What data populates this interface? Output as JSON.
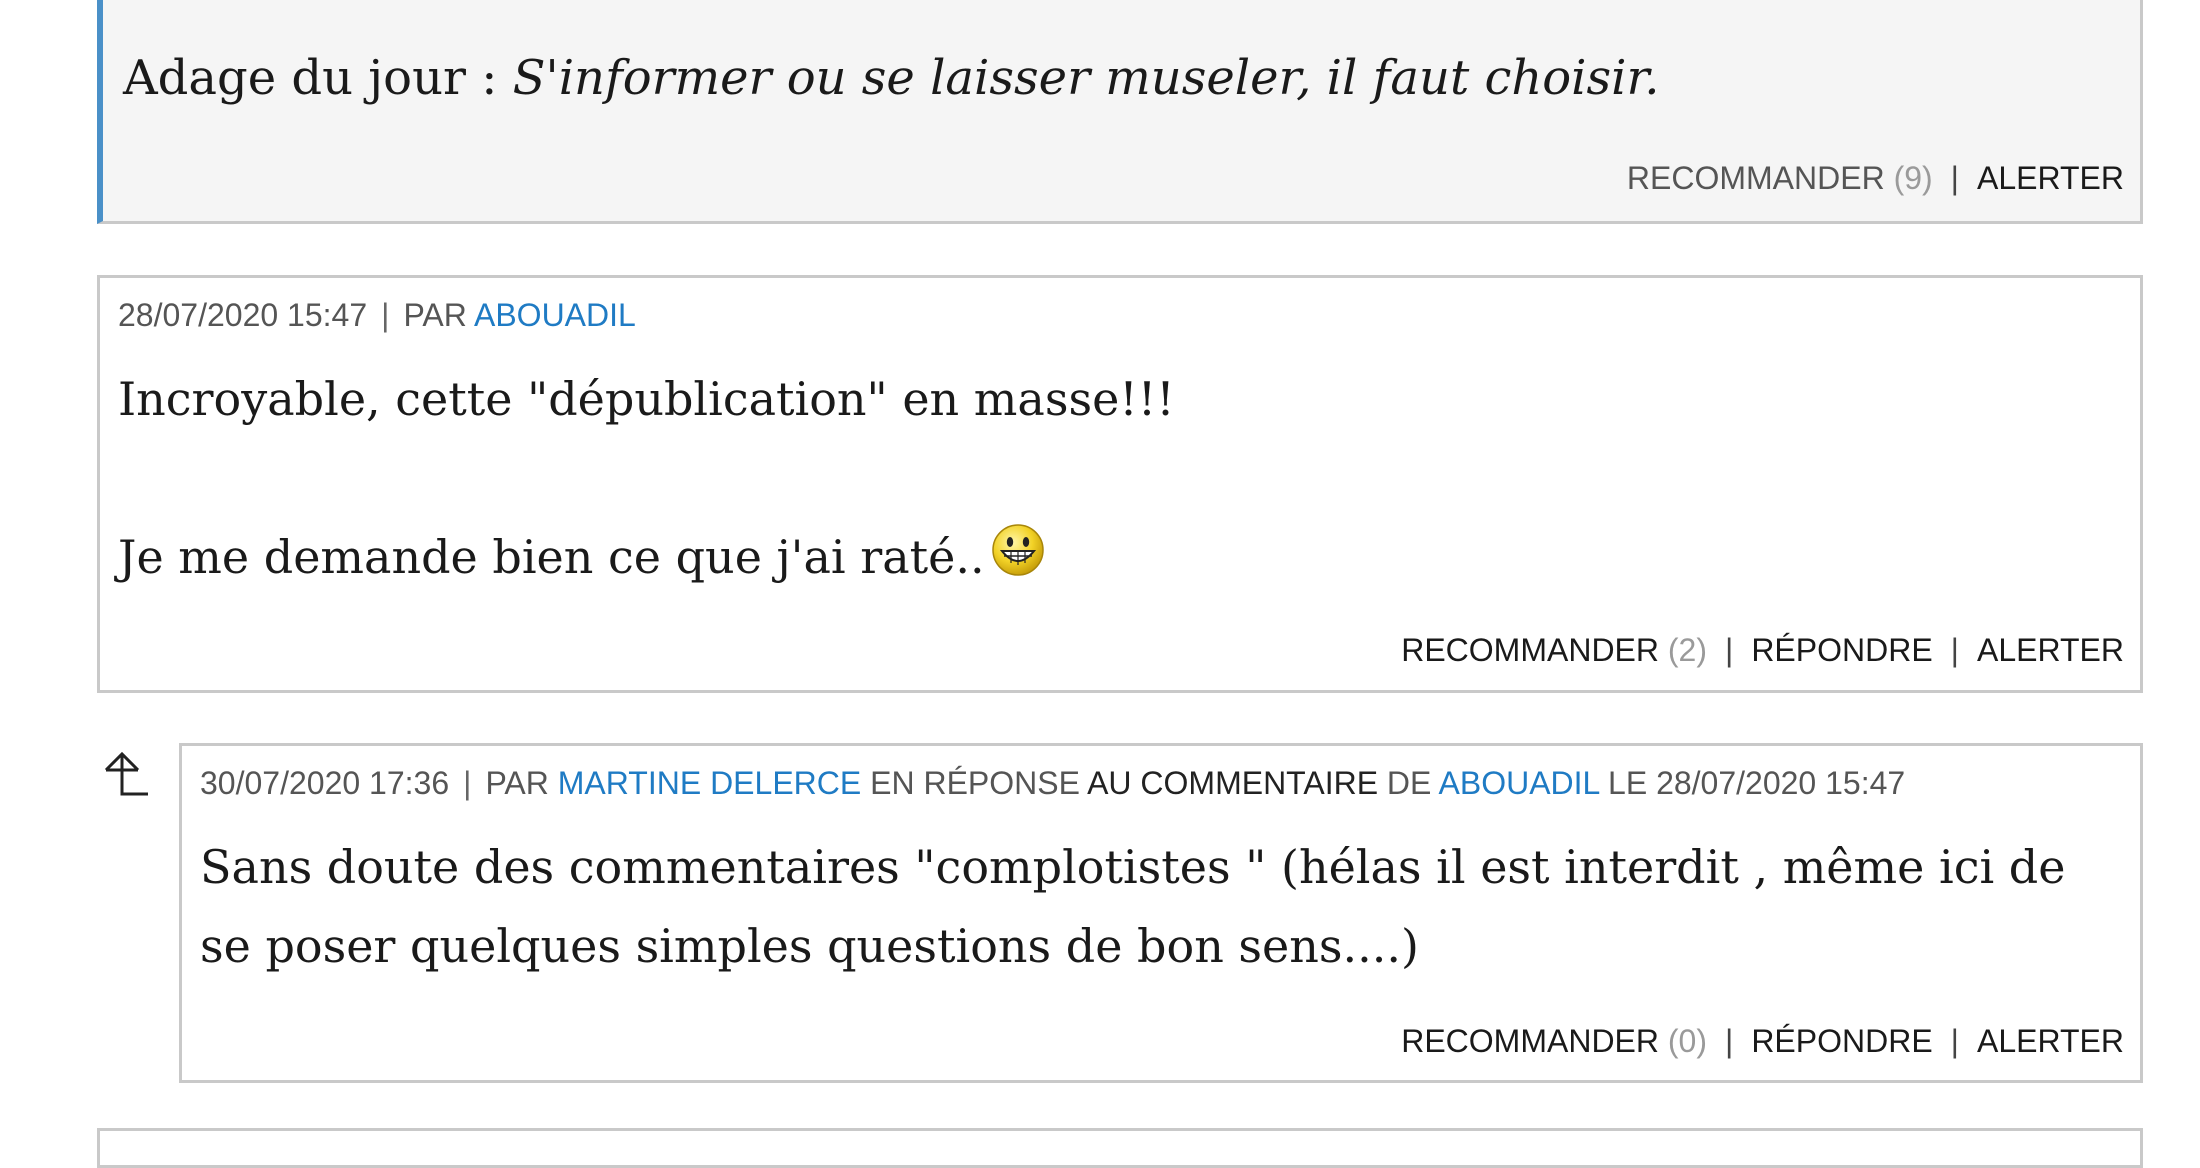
{
  "comments": [
    {
      "body_prefix": "Adage du jour : ",
      "body_italic": "S'informer ou se laisser museler, il faut choisir.",
      "recommend_label": "RECOMMANDER",
      "recommend_count": "(9)",
      "separator": "|",
      "alert_label": "ALERTER"
    },
    {
      "date": "28/07/2020 15:47",
      "separator": "|",
      "by_label": "PAR",
      "author": "ABOUADIL",
      "paragraphs": [
        "Incroyable, cette \"dépublication\" en masse!!!",
        "Je me demande bien ce que j'ai raté.."
      ],
      "emoticon": "grinning-smiley-icon",
      "recommend_label": "RECOMMANDER",
      "recommend_count": "(2)",
      "reply_label": "RÉPONDRE",
      "alert_label": "ALERTER"
    },
    {
      "date": "30/07/2020 17:36",
      "separator": "|",
      "by_label": "PAR",
      "author": "MARTINE DELERCE",
      "in_reply_label": "EN RÉPONSE",
      "comment_link_label": "AU COMMENTAIRE",
      "of_label": "DE",
      "reply_to_author": "ABOUADIL",
      "on_label": "LE",
      "reply_to_date": "28/07/2020 15:47",
      "body": "Sans doute des commentaires \"complotistes \" (hélas il est interdit , même ici de se poser quelques simples questions de bon sens....)",
      "recommend_label": "RECOMMANDER",
      "recommend_count": "(0)",
      "reply_label": "RÉPONDRE",
      "alert_label": "ALERTER"
    }
  ],
  "colors": {
    "author_link": "#1f7bc4",
    "border": "#c9c9c9",
    "highlight_bar": "#4a90c8",
    "muted_count": "#9a9a9a"
  }
}
